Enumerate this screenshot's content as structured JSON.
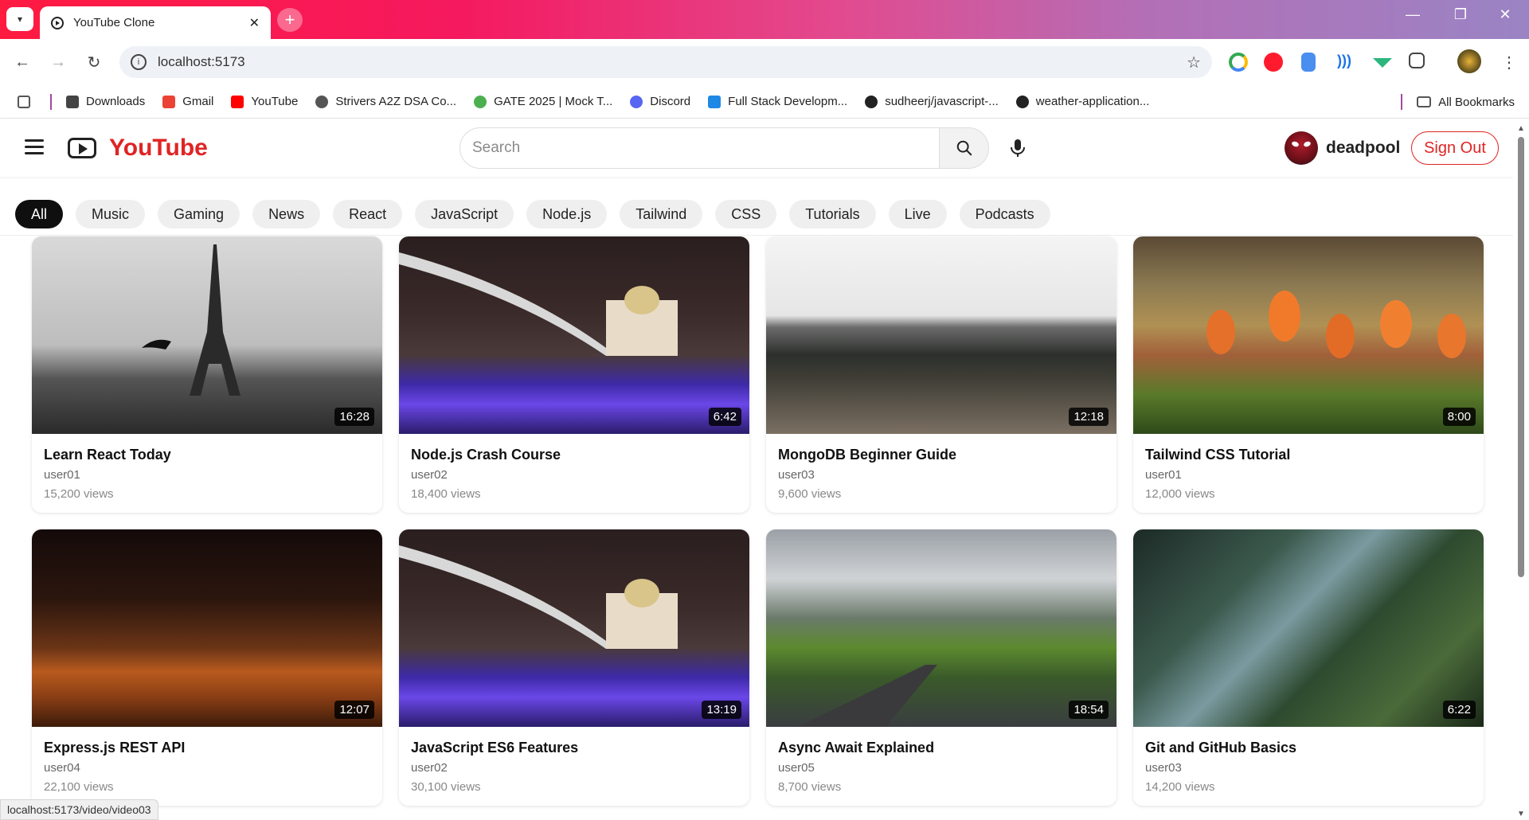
{
  "browser": {
    "tab_title": "YouTube Clone",
    "url": "localhost:5173",
    "status_url": "localhost:5173/video/video03",
    "bookmarks": [
      {
        "label": "Downloads",
        "color": "#444444"
      },
      {
        "label": "Gmail",
        "color": "#ea4335"
      },
      {
        "label": "YouTube",
        "color": "#ff0000"
      },
      {
        "label": "Strivers A2Z DSA Co...",
        "color": "#555555"
      },
      {
        "label": "GATE 2025 | Mock T...",
        "color": "#4caf50"
      },
      {
        "label": "Discord",
        "color": "#5865f2"
      },
      {
        "label": "Full Stack Developm...",
        "color": "#1e88e5"
      },
      {
        "label": "sudheerj/javascript-...",
        "color": "#222222"
      },
      {
        "label": "weather-application...",
        "color": "#222222"
      }
    ],
    "all_bookmarks": "All Bookmarks"
  },
  "header": {
    "logo": "YouTube",
    "search_placeholder": "Search",
    "username": "deadpool",
    "signout": "Sign Out",
    "brand_color": "#e02424"
  },
  "categories": [
    "All",
    "Music",
    "Gaming",
    "News",
    "React",
    "JavaScript",
    "Node.js",
    "Tailwind",
    "CSS",
    "Tutorials",
    "Live",
    "Podcasts"
  ],
  "videos": [
    {
      "title": "Learn React Today",
      "channel": "user01",
      "views": "15,200 views",
      "duration": "16:28",
      "scene": "paris"
    },
    {
      "title": "Node.js Crash Course",
      "channel": "user02",
      "views": "18,400 views",
      "duration": "6:42",
      "scene": "bridge"
    },
    {
      "title": "MongoDB Beginner Guide",
      "channel": "user03",
      "views": "9,600 views",
      "duration": "12:18",
      "scene": "forest"
    },
    {
      "title": "Tailwind CSS Tutorial",
      "channel": "user01",
      "views": "12,000 views",
      "duration": "8:00",
      "scene": "tulip"
    },
    {
      "title": "Express.js REST API",
      "channel": "user04",
      "views": "22,100 views",
      "duration": "12:07",
      "scene": "desert"
    },
    {
      "title": "JavaScript ES6 Features",
      "channel": "user02",
      "views": "30,100 views",
      "duration": "13:19",
      "scene": "bridge"
    },
    {
      "title": "Async Await Explained",
      "channel": "user05",
      "views": "8,700 views",
      "duration": "18:54",
      "scene": "valley"
    },
    {
      "title": "Git and GitHub Basics",
      "channel": "user03",
      "views": "14,200 views",
      "duration": "6:22",
      "scene": "rocks"
    }
  ]
}
